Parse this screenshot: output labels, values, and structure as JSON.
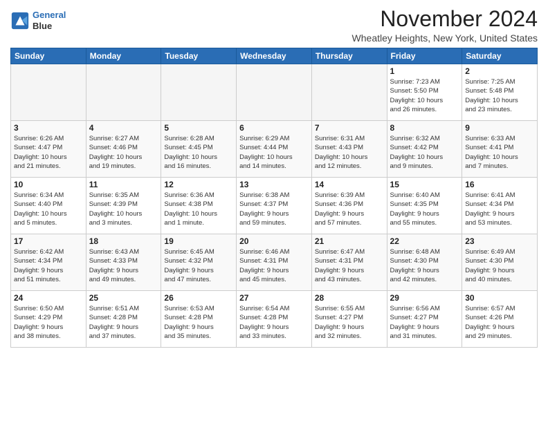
{
  "header": {
    "logo_line1": "General",
    "logo_line2": "Blue",
    "month_title": "November 2024",
    "location": "Wheatley Heights, New York, United States"
  },
  "weekdays": [
    "Sunday",
    "Monday",
    "Tuesday",
    "Wednesday",
    "Thursday",
    "Friday",
    "Saturday"
  ],
  "weeks": [
    [
      {
        "day": "",
        "info": ""
      },
      {
        "day": "",
        "info": ""
      },
      {
        "day": "",
        "info": ""
      },
      {
        "day": "",
        "info": ""
      },
      {
        "day": "",
        "info": ""
      },
      {
        "day": "1",
        "info": "Sunrise: 7:23 AM\nSunset: 5:50 PM\nDaylight: 10 hours\nand 26 minutes."
      },
      {
        "day": "2",
        "info": "Sunrise: 7:25 AM\nSunset: 5:48 PM\nDaylight: 10 hours\nand 23 minutes."
      }
    ],
    [
      {
        "day": "3",
        "info": "Sunrise: 6:26 AM\nSunset: 4:47 PM\nDaylight: 10 hours\nand 21 minutes."
      },
      {
        "day": "4",
        "info": "Sunrise: 6:27 AM\nSunset: 4:46 PM\nDaylight: 10 hours\nand 19 minutes."
      },
      {
        "day": "5",
        "info": "Sunrise: 6:28 AM\nSunset: 4:45 PM\nDaylight: 10 hours\nand 16 minutes."
      },
      {
        "day": "6",
        "info": "Sunrise: 6:29 AM\nSunset: 4:44 PM\nDaylight: 10 hours\nand 14 minutes."
      },
      {
        "day": "7",
        "info": "Sunrise: 6:31 AM\nSunset: 4:43 PM\nDaylight: 10 hours\nand 12 minutes."
      },
      {
        "day": "8",
        "info": "Sunrise: 6:32 AM\nSunset: 4:42 PM\nDaylight: 10 hours\nand 9 minutes."
      },
      {
        "day": "9",
        "info": "Sunrise: 6:33 AM\nSunset: 4:41 PM\nDaylight: 10 hours\nand 7 minutes."
      }
    ],
    [
      {
        "day": "10",
        "info": "Sunrise: 6:34 AM\nSunset: 4:40 PM\nDaylight: 10 hours\nand 5 minutes."
      },
      {
        "day": "11",
        "info": "Sunrise: 6:35 AM\nSunset: 4:39 PM\nDaylight: 10 hours\nand 3 minutes."
      },
      {
        "day": "12",
        "info": "Sunrise: 6:36 AM\nSunset: 4:38 PM\nDaylight: 10 hours\nand 1 minute."
      },
      {
        "day": "13",
        "info": "Sunrise: 6:38 AM\nSunset: 4:37 PM\nDaylight: 9 hours\nand 59 minutes."
      },
      {
        "day": "14",
        "info": "Sunrise: 6:39 AM\nSunset: 4:36 PM\nDaylight: 9 hours\nand 57 minutes."
      },
      {
        "day": "15",
        "info": "Sunrise: 6:40 AM\nSunset: 4:35 PM\nDaylight: 9 hours\nand 55 minutes."
      },
      {
        "day": "16",
        "info": "Sunrise: 6:41 AM\nSunset: 4:34 PM\nDaylight: 9 hours\nand 53 minutes."
      }
    ],
    [
      {
        "day": "17",
        "info": "Sunrise: 6:42 AM\nSunset: 4:34 PM\nDaylight: 9 hours\nand 51 minutes."
      },
      {
        "day": "18",
        "info": "Sunrise: 6:43 AM\nSunset: 4:33 PM\nDaylight: 9 hours\nand 49 minutes."
      },
      {
        "day": "19",
        "info": "Sunrise: 6:45 AM\nSunset: 4:32 PM\nDaylight: 9 hours\nand 47 minutes."
      },
      {
        "day": "20",
        "info": "Sunrise: 6:46 AM\nSunset: 4:31 PM\nDaylight: 9 hours\nand 45 minutes."
      },
      {
        "day": "21",
        "info": "Sunrise: 6:47 AM\nSunset: 4:31 PM\nDaylight: 9 hours\nand 43 minutes."
      },
      {
        "day": "22",
        "info": "Sunrise: 6:48 AM\nSunset: 4:30 PM\nDaylight: 9 hours\nand 42 minutes."
      },
      {
        "day": "23",
        "info": "Sunrise: 6:49 AM\nSunset: 4:30 PM\nDaylight: 9 hours\nand 40 minutes."
      }
    ],
    [
      {
        "day": "24",
        "info": "Sunrise: 6:50 AM\nSunset: 4:29 PM\nDaylight: 9 hours\nand 38 minutes."
      },
      {
        "day": "25",
        "info": "Sunrise: 6:51 AM\nSunset: 4:28 PM\nDaylight: 9 hours\nand 37 minutes."
      },
      {
        "day": "26",
        "info": "Sunrise: 6:53 AM\nSunset: 4:28 PM\nDaylight: 9 hours\nand 35 minutes."
      },
      {
        "day": "27",
        "info": "Sunrise: 6:54 AM\nSunset: 4:28 PM\nDaylight: 9 hours\nand 33 minutes."
      },
      {
        "day": "28",
        "info": "Sunrise: 6:55 AM\nSunset: 4:27 PM\nDaylight: 9 hours\nand 32 minutes."
      },
      {
        "day": "29",
        "info": "Sunrise: 6:56 AM\nSunset: 4:27 PM\nDaylight: 9 hours\nand 31 minutes."
      },
      {
        "day": "30",
        "info": "Sunrise: 6:57 AM\nSunset: 4:26 PM\nDaylight: 9 hours\nand 29 minutes."
      }
    ]
  ]
}
